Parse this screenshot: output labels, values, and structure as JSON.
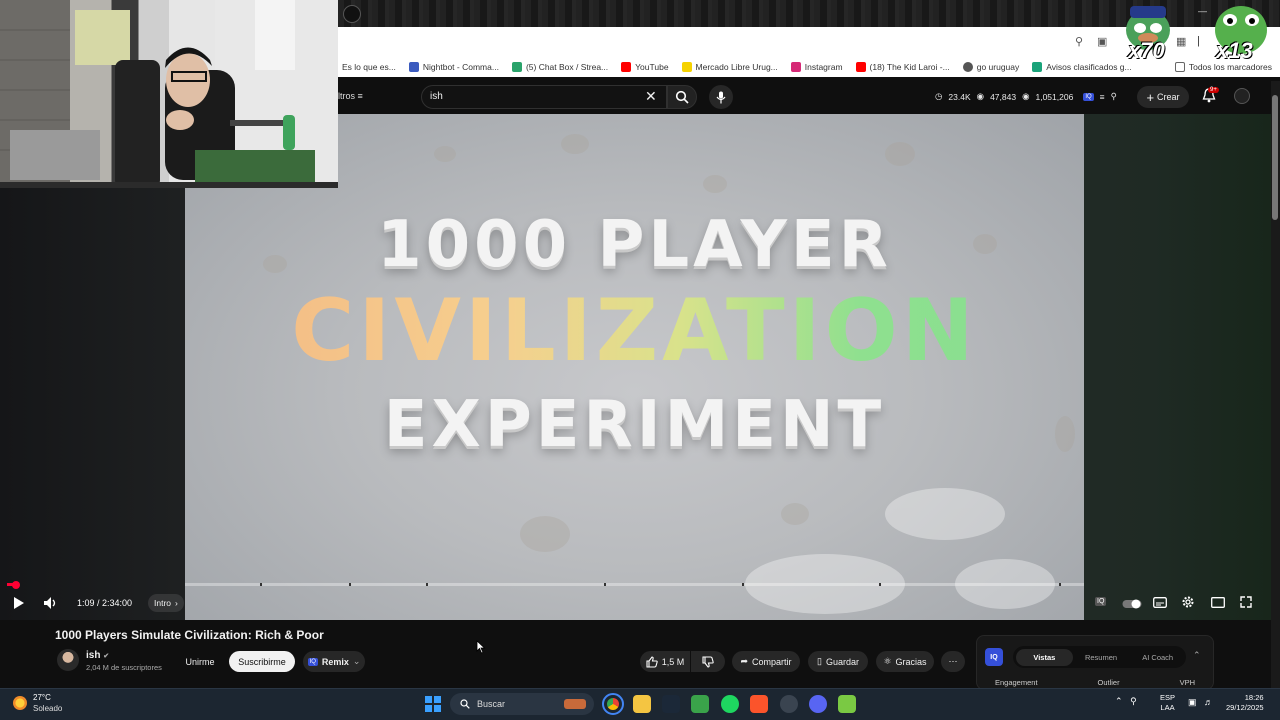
{
  "browser": {
    "bookmarks": [
      {
        "label": "Es lo que es...",
        "color": "#777777"
      },
      {
        "label": "Nightbot - Comma...",
        "color": "#3b5bbf"
      },
      {
        "label": "(5) Chat Box / Strea...",
        "color": "#2aa36b"
      },
      {
        "label": "YouTube",
        "color": "#ff0000"
      },
      {
        "label": "Mercado Libre Urug...",
        "color": "#f5d200"
      },
      {
        "label": "Instagram",
        "color": "#d62976"
      },
      {
        "label": "(18) The Kid Laroi -...",
        "color": "#ff0000"
      },
      {
        "label": "go uruguay",
        "color": "#555555"
      },
      {
        "label": "Avisos clasificados g...",
        "color": "#1aa37a"
      }
    ],
    "all_bookmarks": "Todos los marcadores"
  },
  "youtube": {
    "filters_label": "ltros",
    "search_value": "ish",
    "stats": [
      "23.4K",
      "47,843",
      "1,051,206"
    ],
    "create_label": "Crear",
    "notif_badge": "9+"
  },
  "video": {
    "thumb_line1": "1000 PLAYER",
    "thumb_line2": "CIVILIZATION",
    "thumb_line3": "EXPERIMENT",
    "time": "1:09 / 2:34:00",
    "chapter": "Intro",
    "title": "1000 Players Simulate Civilization: Rich & Poor",
    "channel": "ish",
    "subscribers": "2,04 M de suscriptores",
    "join_label": "Unirme",
    "subscribe_label": "Suscribirme",
    "remix_label": "Remix",
    "likes": "1,5 M",
    "share_label": "Compartir",
    "save_label": "Guardar",
    "thanks_label": "Gracias"
  },
  "iq_panel": {
    "logo": "IQ",
    "tabs": [
      "Vistas",
      "Resumen",
      "AI Coach"
    ],
    "columns": [
      "Engagement",
      "Outlier",
      "VPH"
    ]
  },
  "stickers": {
    "left": "x70",
    "right": "x13"
  },
  "taskbar": {
    "temp": "27°C",
    "weather": "Soleado",
    "search_placeholder": "Buscar",
    "lang_top": "ESP",
    "lang_bottom": "LAA",
    "time": "18:26",
    "date": "29/12/2025"
  },
  "colors": {
    "accent_red": "#ff0033",
    "taskbar": "#1c2631",
    "iq_blue": "#3550d9"
  }
}
